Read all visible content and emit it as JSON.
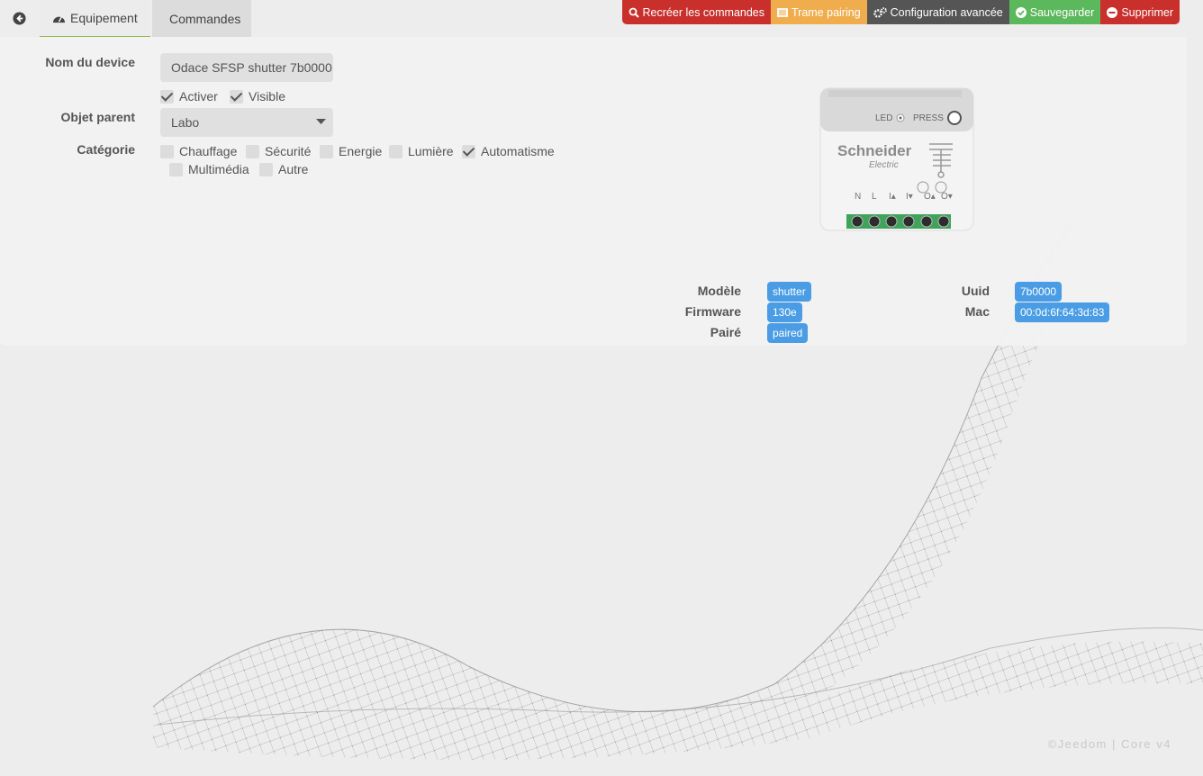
{
  "tabs": {
    "equipement": "Equipement",
    "commandes": "Commandes"
  },
  "actions": [
    {
      "label": "Recréer les commandes",
      "color": "#c9302c",
      "icon": "search-icon"
    },
    {
      "label": "Trame pairing",
      "color": "#f0ad4e",
      "icon": "list-icon"
    },
    {
      "label": "Configuration avancée",
      "color": "#555555",
      "icon": "cogs-icon"
    },
    {
      "label": "Sauvegarder",
      "color": "#5cb85c",
      "icon": "check-circle-icon"
    },
    {
      "label": "Supprimer",
      "color": "#c9302c",
      "icon": "minus-circle-icon"
    }
  ],
  "form": {
    "name_label": "Nom du device",
    "name_value": "Odace SFSP  shutter 7b0000",
    "activer_label": "Activer",
    "visible_label": "Visible",
    "parent_label": "Objet parent",
    "parent_value": "Labo",
    "category_label": "Catégorie",
    "categories": [
      {
        "label": "Chauffage",
        "checked": false
      },
      {
        "label": "Sécurité",
        "checked": false
      },
      {
        "label": "Energie",
        "checked": false
      },
      {
        "label": "Lumière",
        "checked": false
      },
      {
        "label": "Automatisme",
        "checked": true
      },
      {
        "label": "Multimédia",
        "checked": false
      },
      {
        "label": "Autre",
        "checked": false
      }
    ]
  },
  "device_image": {
    "brand": "Schneider",
    "brand_sub": "Electric",
    "led_label": "LED",
    "press_label": "PRESS",
    "terminals": [
      "N",
      "L",
      "I▴",
      "I▾",
      "O▴",
      "O▾"
    ]
  },
  "info": {
    "model_label": "Modèle",
    "model_value": "shutter",
    "firmware_label": "Firmware",
    "firmware_value": "130e",
    "paired_label": "Pairé",
    "paired_value": "paired",
    "uuid_label": "Uuid",
    "uuid_value": "7b0000",
    "mac_label": "Mac",
    "mac_value": "00:0d:6f:64:3d:83"
  },
  "footer": "©Jeedom | Core v4"
}
